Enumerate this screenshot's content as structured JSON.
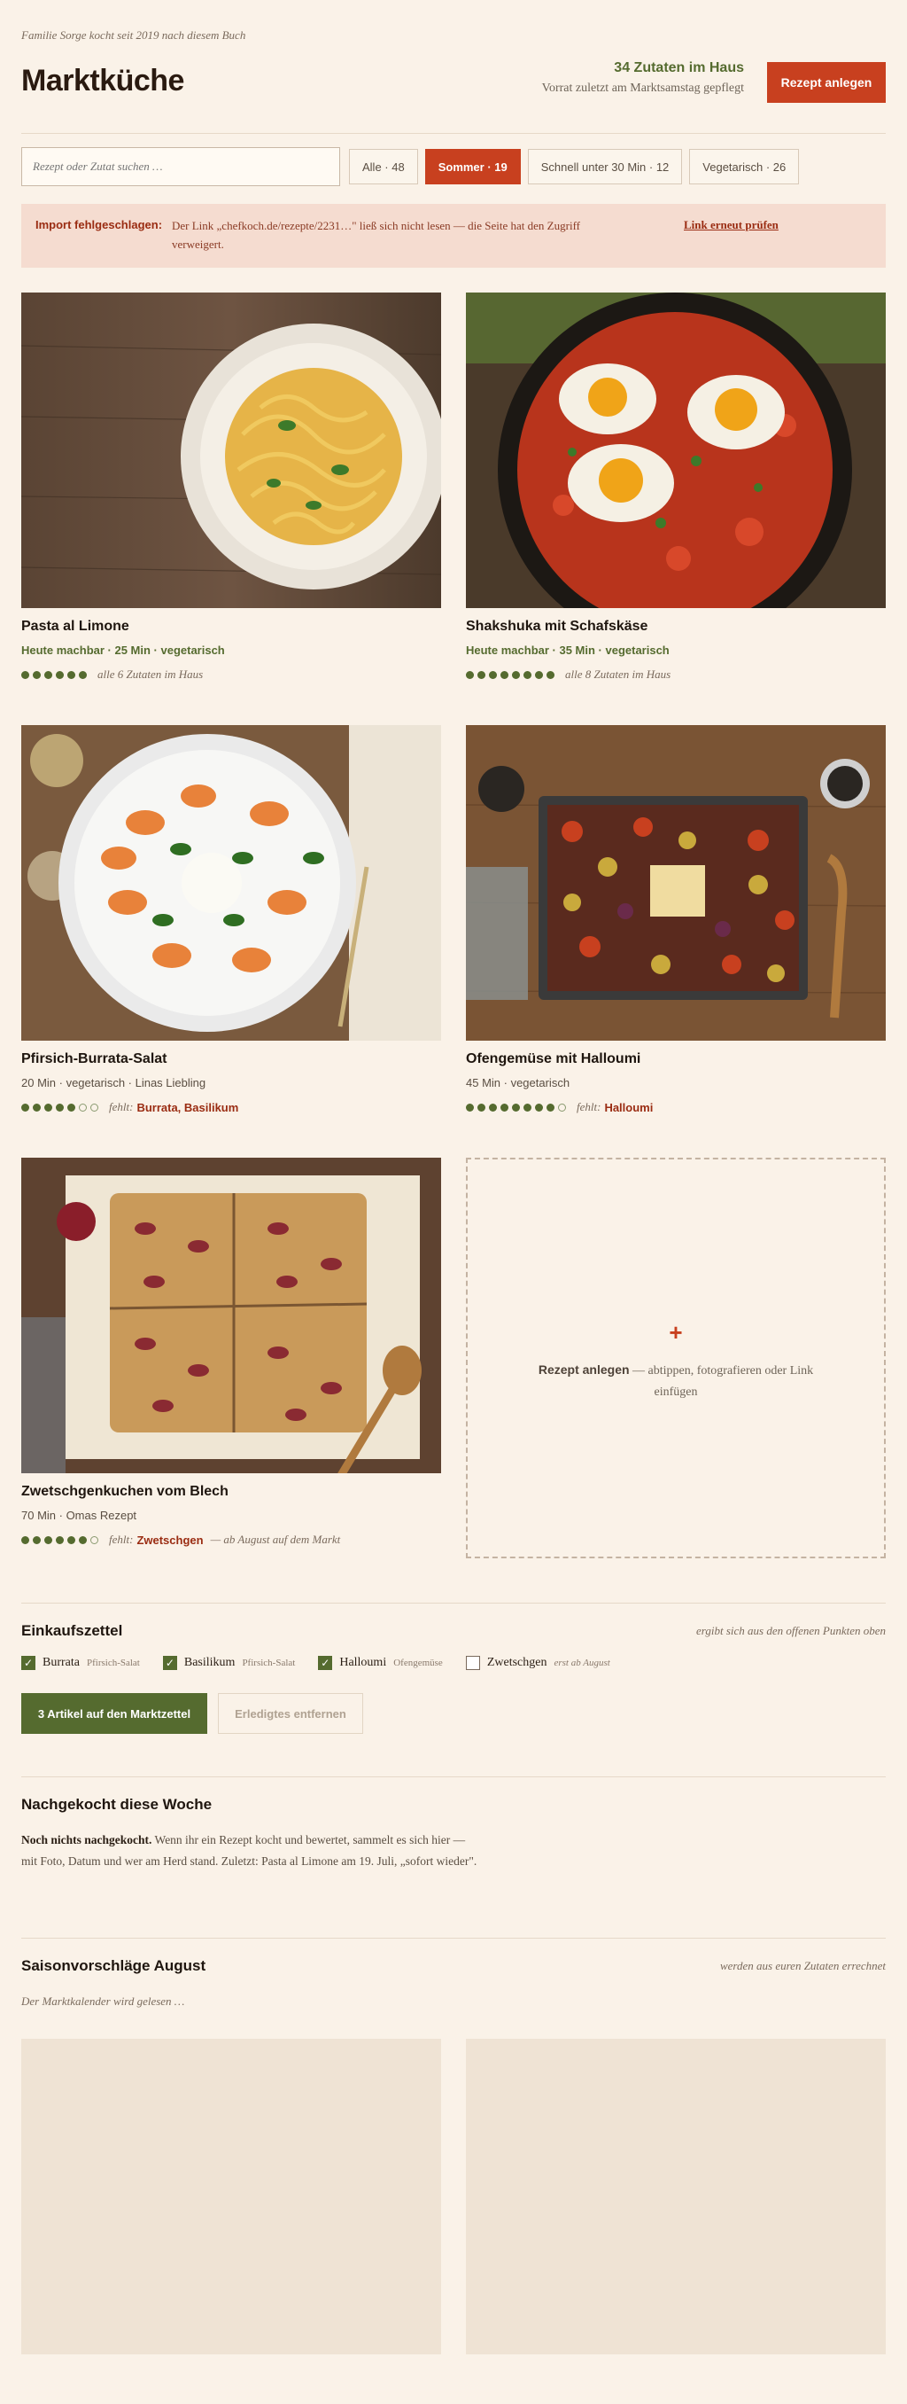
{
  "header": {
    "tagline": "Familie Sorge kocht seit 2019 nach diesem Buch",
    "title": "Marktküche",
    "stock_count": "34 Zutaten im Haus",
    "stock_sub": "Vorrat zuletzt am Marktsamstag gepflegt",
    "create_button": "Rezept anlegen"
  },
  "search": {
    "placeholder": "Rezept oder Zutat suchen …"
  },
  "filters": [
    {
      "label": "Alle · 48",
      "active": false
    },
    {
      "label": "Sommer · 19",
      "active": true
    },
    {
      "label": "Schnell unter 30 Min · 12",
      "active": false
    },
    {
      "label": "Vegetarisch · 26",
      "active": false
    }
  ],
  "alert": {
    "label": "Import fehlgeschlagen:",
    "message": "Der Link „chefkoch.de/rezepte/2231…\" ließ sich nicht lesen — die Seite hat den Zugriff verweigert.",
    "action": "Link erneut prüfen"
  },
  "recipes": [
    {
      "name": "Pasta al Limone",
      "meta": "Heute machbar · 25 Min · vegetarisch",
      "ok": true,
      "dots": 6,
      "empty_dots": 0,
      "note": "alle 6 Zutaten im Haus",
      "missing": ""
    },
    {
      "name": "Shakshuka mit Schafskäse",
      "meta": "Heute machbar · 35 Min · vegetarisch",
      "ok": true,
      "dots": 8,
      "empty_dots": 0,
      "note": "alle 8 Zutaten im Haus",
      "missing": ""
    },
    {
      "name": "Pfirsich-Burrata-Salat",
      "meta": "20 Min · vegetarisch · Linas Liebling",
      "ok": false,
      "dots": 5,
      "empty_dots": 2,
      "note": "fehlt:",
      "missing": "Burrata, Basilikum",
      "tail": ""
    },
    {
      "name": "Ofengemüse mit Halloumi",
      "meta": "45 Min · vegetarisch",
      "ok": false,
      "dots": 8,
      "empty_dots": 1,
      "note": "fehlt:",
      "missing": "Halloumi",
      "tail": ""
    },
    {
      "name": "Zwetschgenkuchen vom Blech",
      "meta": "70 Min · Omas Rezept",
      "ok": false,
      "dots": 6,
      "empty_dots": 1,
      "note": "fehlt:",
      "missing": "Zwetschgen",
      "tail": "— ab August auf dem Markt"
    }
  ],
  "add_card": {
    "plus": "+",
    "bold": "Rezept anlegen",
    "text": "— abtippen, fotografieren oder Link einfügen"
  },
  "shopping": {
    "title": "Einkaufszettel",
    "note": "ergibt sich aus den offenen Punkten oben",
    "items": [
      {
        "name": "Burrata",
        "source": "Pfirsich-Salat",
        "checked": true
      },
      {
        "name": "Basilikum",
        "source": "Pfirsich-Salat",
        "checked": true
      },
      {
        "name": "Halloumi",
        "source": "Ofengemüse",
        "checked": true
      },
      {
        "name": "Zwetschgen",
        "source": "erst ab August",
        "checked": false
      }
    ],
    "add_button": "3 Artikel auf den Marktzettel",
    "clear_button": "Erledigtes entfernen"
  },
  "cooked": {
    "title": "Nachgekocht diese Woche",
    "bold": "Noch nichts nachgekocht.",
    "text": "Wenn ihr ein Rezept kocht und bewertet, sammelt es sich hier — mit Foto, Datum und wer am Herd stand. Zuletzt: Pasta al Limone am 19. Juli, „sofort wieder\"."
  },
  "season": {
    "title": "Saisonvorschläge August",
    "note": "werden aus euren Zutaten errechnet",
    "loading": "Der Marktkalender wird gelesen …"
  }
}
